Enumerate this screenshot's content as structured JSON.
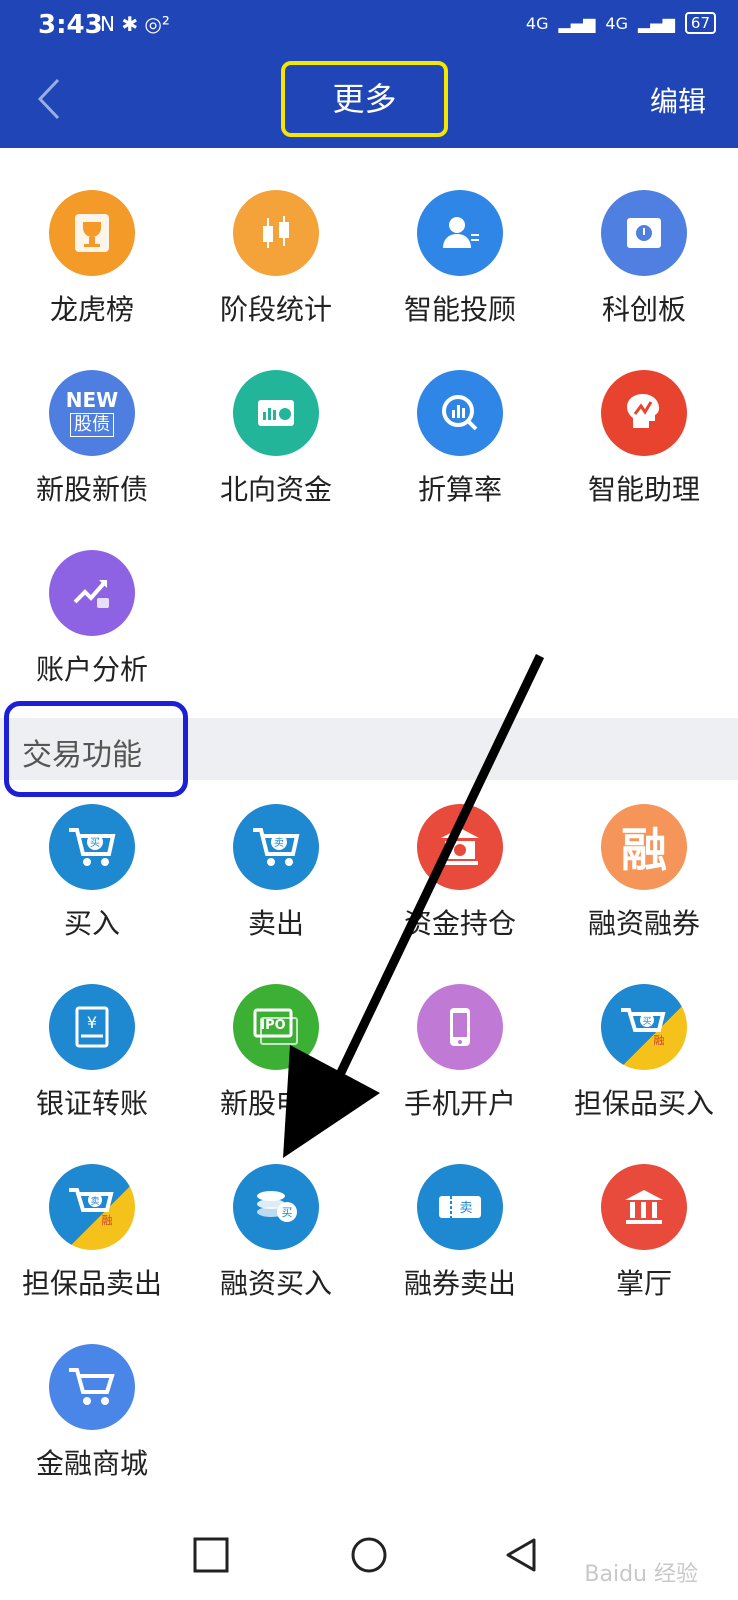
{
  "status": {
    "time": "3:43",
    "signal1": "4G",
    "signal2": "4G",
    "battery": "67"
  },
  "header": {
    "title": "更多",
    "edit_label": "编辑"
  },
  "icons": {
    "annotation_arrow": "black-arrow-annotation",
    "highlight_box_color": "#f5e600",
    "section_box_color": "#1d1fd6",
    "header_color": "#1f45b6"
  },
  "top_items": [
    {
      "label": "龙虎榜",
      "icon": "trophy-icon"
    },
    {
      "label": "阶段统计",
      "icon": "candlestick-icon"
    },
    {
      "label": "智能投顾",
      "icon": "advisor-icon"
    },
    {
      "label": "科创板",
      "icon": "star-board-icon"
    },
    {
      "label": "新股新债",
      "icon": "new-stock-bond-icon",
      "badge_top": "NEW",
      "badge_bottom": "股债"
    },
    {
      "label": "北向资金",
      "icon": "northbound-fund-icon"
    },
    {
      "label": "折算率",
      "icon": "conversion-rate-icon"
    },
    {
      "label": "智能助理",
      "icon": "ai-assistant-icon"
    },
    {
      "label": "账户分析",
      "icon": "account-analysis-icon"
    }
  ],
  "section": {
    "title": "交易功能"
  },
  "trade_items": [
    {
      "label": "买入",
      "icon": "buy-cart-icon",
      "glyph": "买"
    },
    {
      "label": "卖出",
      "icon": "sell-cart-icon",
      "glyph": "卖"
    },
    {
      "label": "资金持仓",
      "icon": "bank-holding-icon"
    },
    {
      "label": "融资融券",
      "icon": "margin-icon",
      "glyph": "融"
    },
    {
      "label": "银证转账",
      "icon": "bank-transfer-icon",
      "glyph": "¥"
    },
    {
      "label": "新股申购",
      "icon": "ipo-icon",
      "glyph": "IPO"
    },
    {
      "label": "手机开户",
      "icon": "mobile-account-icon"
    },
    {
      "label": "担保品买入",
      "icon": "collateral-buy-icon",
      "glyph": "买",
      "glyph2": "融"
    },
    {
      "label": "担保品卖出",
      "icon": "collateral-sell-icon",
      "glyph": "卖",
      "glyph2": "融"
    },
    {
      "label": "融资买入",
      "icon": "margin-buy-icon",
      "glyph": "买"
    },
    {
      "label": "融券卖出",
      "icon": "short-sell-icon",
      "glyph": "卖"
    },
    {
      "label": "掌厅",
      "icon": "hall-icon"
    },
    {
      "label": "金融商城",
      "icon": "mall-cart-icon"
    }
  ],
  "watermark": "Baidu 经验"
}
